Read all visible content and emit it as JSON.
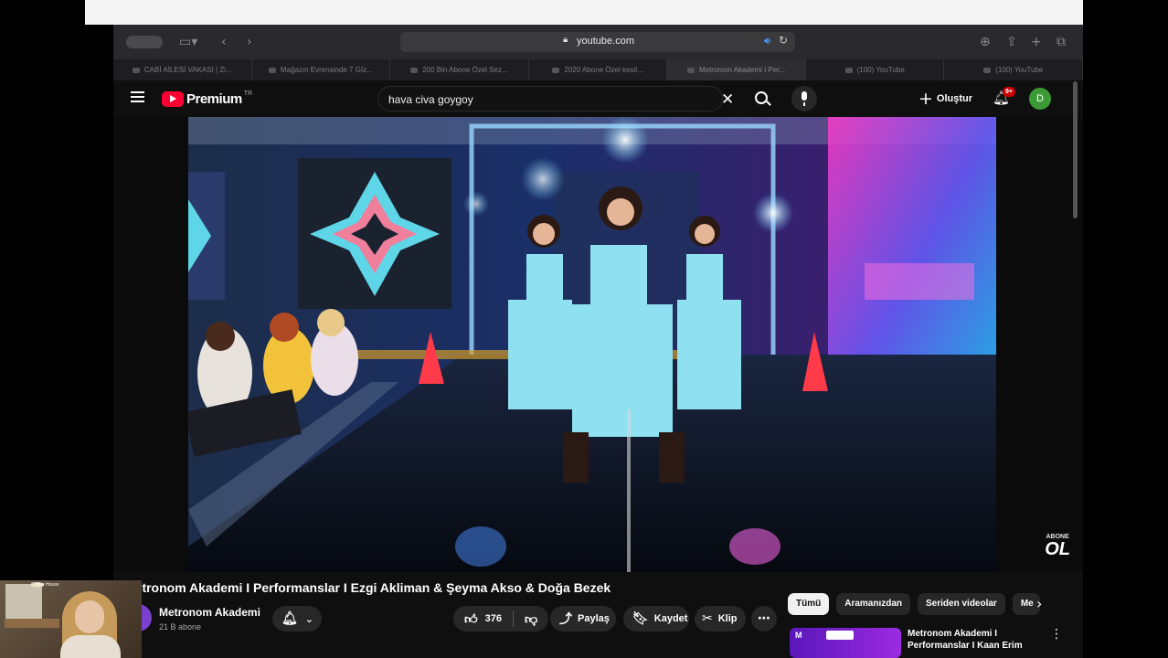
{
  "browser": {
    "url": "youtube.com",
    "tabs": [
      {
        "label": "CABİ AİLESİ VAKASI | Zi..."
      },
      {
        "label": "Mağazın Evrensinde 7 Gİz..."
      },
      {
        "label": "200 Bin Abone Özel Sez..."
      },
      {
        "label": "2020 Abone Özel kesil..."
      },
      {
        "label": "Metronom Akademi I Per..."
      },
      {
        "label": "(100) YouTube"
      },
      {
        "label": "(100) YouTube"
      }
    ]
  },
  "youtube": {
    "logo_text": "Premium",
    "logo_superscript": "TR",
    "search_query": "hava civa goygoy",
    "create_label": "Oluştur",
    "notification_badge": "9+",
    "avatar_letter": "D"
  },
  "video": {
    "watermark_top": "ABONE",
    "watermark_bottom": "OL",
    "title": "Metronom Akademi I Performanslar I Ezgi Akliman & Şeyma Akso & Doğa Bezek",
    "channel_name": "Metronom Akademi",
    "subscribers": "21 B abone",
    "like_count": "376",
    "share_label": "Paylaş",
    "save_label": "Kaydet",
    "clip_label": "Klip"
  },
  "sidebar": {
    "chips": [
      {
        "label": "Tümü",
        "active": true
      },
      {
        "label": "Aramanızdan",
        "active": false
      },
      {
        "label": "Seriden videolar",
        "active": false
      },
      {
        "label": "Me",
        "active": false
      }
    ],
    "recommendation_title": "Metronom Akademi I Performanslar I Kaan Erim",
    "recommendation_thumb_letter": "M"
  },
  "webcam": {
    "sign_text": "Coffee House"
  },
  "colors": {
    "youtube_red": "#ff0033",
    "avatar_green": "#3c9b35",
    "badge_red": "#cc0000",
    "channel_purple": "#7b3fd0"
  },
  "icons": [
    "apple-icon",
    "sidebar-toggle-icon",
    "back-icon",
    "forward-icon",
    "lock-icon",
    "sound-icon",
    "reload-icon",
    "download-icon",
    "share-icon",
    "new-tab-icon",
    "tabs-overview-icon",
    "menu-icon",
    "clear-icon",
    "search-icon",
    "mic-icon",
    "plus-icon",
    "bell-icon",
    "like-icon",
    "dislike-icon",
    "share-arrow-icon",
    "bookmark-icon",
    "scissors-icon",
    "more-icon",
    "chevron-right-icon"
  ]
}
